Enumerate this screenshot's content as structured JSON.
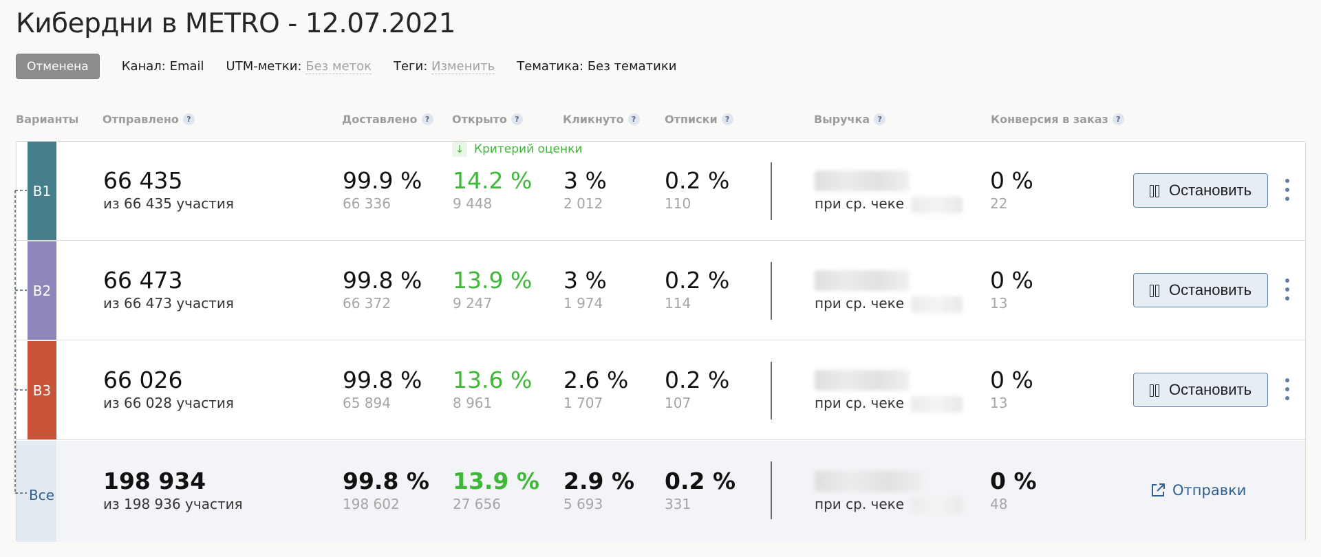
{
  "title": "Кибердни в METRO - 12.07.2021",
  "meta": {
    "status": "Отменена",
    "channel": "Канал: Email",
    "utm_label": "UTM-метки:",
    "utm_value": "Без меток",
    "tags_label": "Теги:",
    "tags_value": "Изменить",
    "topic": "Тематика: Без тематики"
  },
  "columns": {
    "variants": "Варианты",
    "sent": "Отправлено",
    "delivered": "Доставлено",
    "opened": "Открыто",
    "clicked": "Кликнуто",
    "unsubscribed": "Отписки",
    "revenue": "Выручка",
    "conversion": "Конверсия в заказ",
    "help": "?"
  },
  "criterion": "Критерий оценки",
  "criterion_icon": "arrow-down-icon",
  "variants": [
    {
      "label": "B1",
      "color": "#457f8b",
      "sent": "66 435",
      "sent_sub": "из 66 435 участия",
      "delivered_pct": "99.9 %",
      "delivered": "66 336",
      "opened_pct": "14.2 %",
      "opened": "9 448",
      "clicked_pct": "3 %",
      "clicked": "2 012",
      "unsub_pct": "0.2 %",
      "unsub": "110",
      "avg_check_label": "при ср. чеке",
      "conv_pct": "0 %",
      "conv": "22",
      "action": "Остановить"
    },
    {
      "label": "B2",
      "color": "#8d86ba",
      "sent": "66 473",
      "sent_sub": "из 66 473 участия",
      "delivered_pct": "99.8 %",
      "delivered": "66 372",
      "opened_pct": "13.9 %",
      "opened": "9 247",
      "clicked_pct": "3 %",
      "clicked": "1 974",
      "unsub_pct": "0.2 %",
      "unsub": "114",
      "avg_check_label": "при ср. чеке",
      "conv_pct": "0 %",
      "conv": "13",
      "action": "Остановить"
    },
    {
      "label": "B3",
      "color": "#c9543a",
      "sent": "66 026",
      "sent_sub": "из 66 028 участия",
      "delivered_pct": "99.8 %",
      "delivered": "65 894",
      "opened_pct": "13.6 %",
      "opened": "8 961",
      "clicked_pct": "2.6 %",
      "clicked": "1 707",
      "unsub_pct": "0.2 %",
      "unsub": "107",
      "avg_check_label": "при ср. чеке",
      "conv_pct": "0 %",
      "conv": "13",
      "action": "Остановить"
    }
  ],
  "total": {
    "label": "Все",
    "sent": "198 934",
    "sent_sub": "из 198 936 участия",
    "delivered_pct": "99.8 %",
    "delivered": "198 602",
    "opened_pct": "13.9 %",
    "opened": "27 656",
    "clicked_pct": "2.9 %",
    "clicked": "5 693",
    "unsub_pct": "0.2 %",
    "unsub": "331",
    "avg_check_label": "при ср. чеке",
    "conv_pct": "0 %",
    "conv": "48",
    "action": "Отправки"
  }
}
